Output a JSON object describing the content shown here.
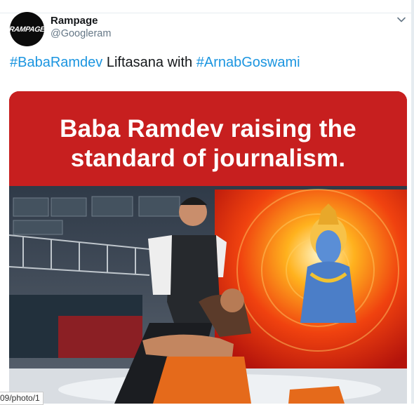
{
  "tweet": {
    "avatar_text": "RAMPAGE",
    "display_name": "Rampage",
    "handle": "@Googleram",
    "text_parts": {
      "hashtag1": "#BabaRamdev",
      "middle": " Liftasana with ",
      "hashtag2": "#ArnabGoswami"
    },
    "caret_icon": "chevron-down-icon"
  },
  "media": {
    "banner_line1": "Baba Ramdev raising the",
    "banner_line2": "standard of journalism."
  },
  "status_url": "09/photo/1",
  "colors": {
    "link": "#1b95e0",
    "banner_red": "#c71f1f",
    "muted": "#657786"
  }
}
